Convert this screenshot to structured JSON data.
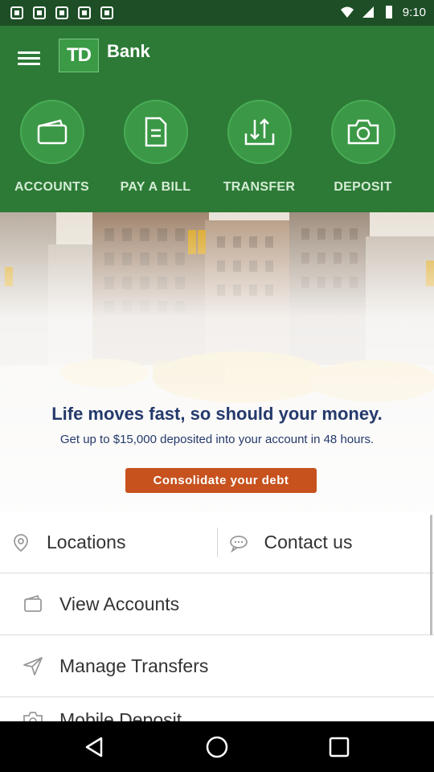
{
  "status_bar": {
    "time": "9:10"
  },
  "app": {
    "logo_mark": "TD",
    "logo_text": "Bank"
  },
  "actions": [
    {
      "label": "ACCOUNTS",
      "icon": "wallet-icon"
    },
    {
      "label": "PAY A BILL",
      "icon": "bill-icon"
    },
    {
      "label": "TRANSFER",
      "icon": "transfer-icon"
    },
    {
      "label": "DEPOSIT",
      "icon": "camera-icon"
    }
  ],
  "banner": {
    "headline": "Life moves fast, so should your money.",
    "subline": "Get up to $15,000 deposited into your account in 48 hours.",
    "cta": "Consolidate your debt"
  },
  "links": {
    "locations": "Locations",
    "contact": "Contact us",
    "view_accounts": "View Accounts",
    "manage_transfers": "Manage Transfers",
    "mobile_deposit": "Mobile Deposit"
  },
  "colors": {
    "status_bar": "#1d4e26",
    "app_bar": "#2d7a36",
    "accent": "#c7521e",
    "headline": "#243a6b"
  }
}
